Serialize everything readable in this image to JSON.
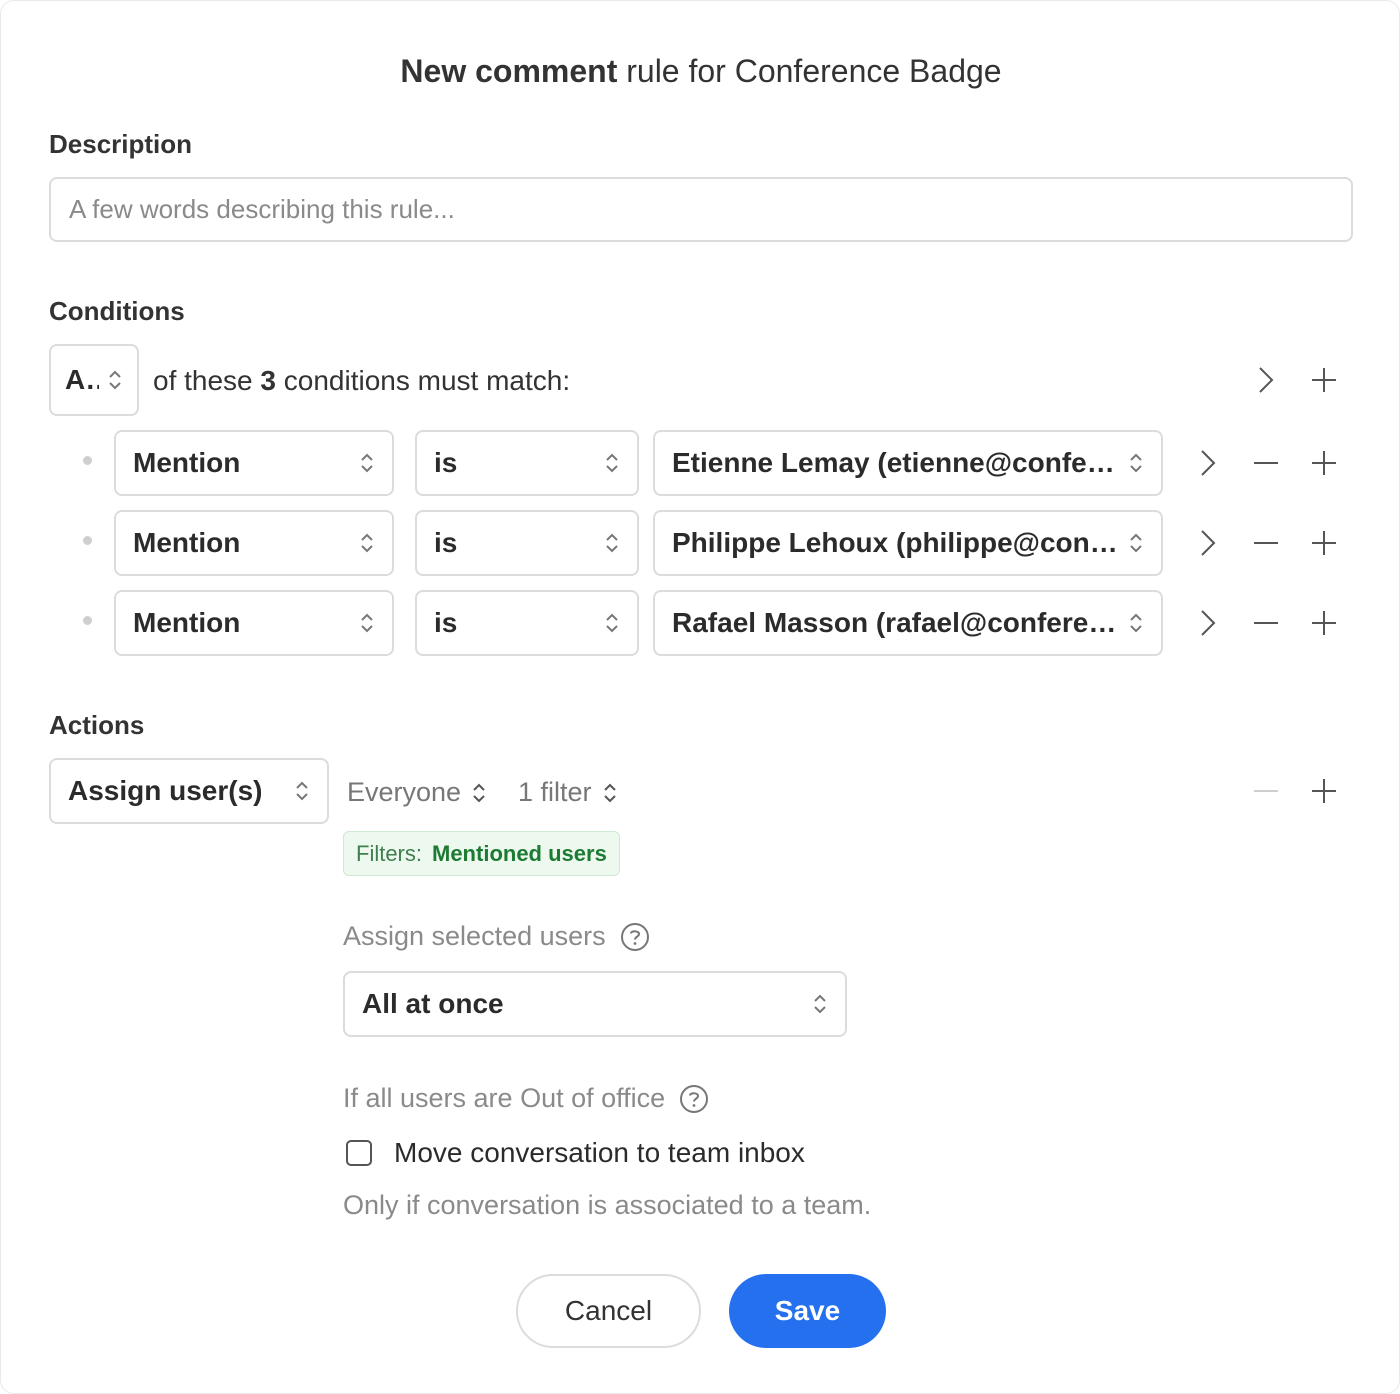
{
  "dialog": {
    "title_bold": "New comment",
    "title_rest": " rule for Conference Badge"
  },
  "description": {
    "label": "Description",
    "placeholder": "A few words describing this rule...",
    "value": ""
  },
  "conditions": {
    "label": "Conditions",
    "match_mode": "All",
    "summary_pre": "of these ",
    "summary_count": "3",
    "summary_post": " conditions must match:",
    "rows": [
      {
        "field": "Mention",
        "operator": "is",
        "value": "Etienne Lemay (etienne@conference.com)"
      },
      {
        "field": "Mention",
        "operator": "is",
        "value": "Philippe Lehoux (philippe@conference.com)"
      },
      {
        "field": "Mention",
        "operator": "is",
        "value": "Rafael Masson (rafael@conference.com)"
      }
    ]
  },
  "actions": {
    "label": "Actions",
    "action": "Assign user(s)",
    "audience": "Everyone",
    "filter_count": "1 filter",
    "filters_key": "Filters:",
    "filters_value": "Mentioned users",
    "assign_label": "Assign selected users",
    "assign_mode": "All at once",
    "ooo_label": "If all users are Out of office",
    "move_label": "Move conversation to team inbox",
    "move_checked": false,
    "note": "Only if conversation is associated to a team."
  },
  "footer": {
    "cancel": "Cancel",
    "save": "Save"
  },
  "colors": {
    "primary": "#2470ee",
    "filter_bg": "#edf8ef",
    "filter_text": "#1d7a33"
  }
}
